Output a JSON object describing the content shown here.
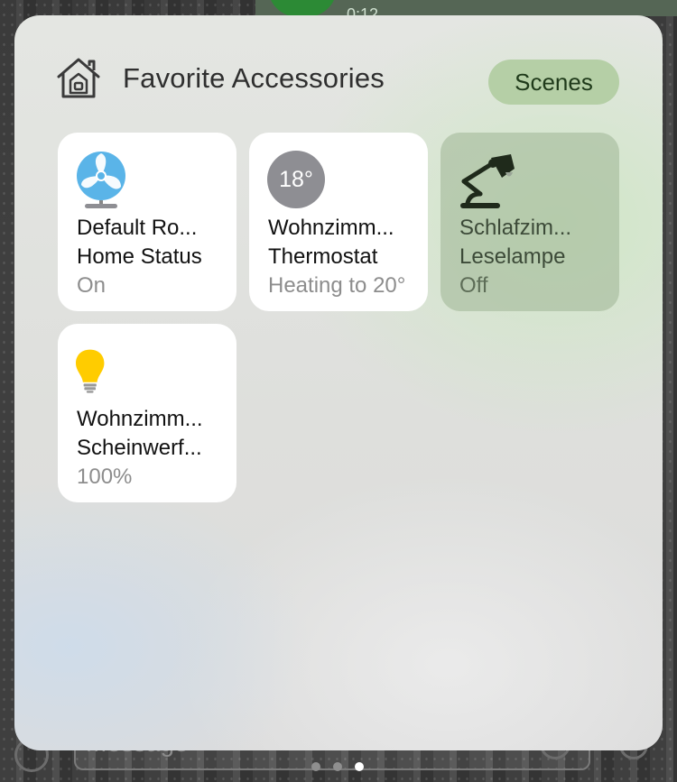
{
  "panel": {
    "title": "Favorite Accessories",
    "scenes_label": "Scenes"
  },
  "accessories": [
    {
      "name_line1": "Default Ro...",
      "name_line2": "Home Status",
      "status": "On",
      "icon": "fan-icon",
      "state": "on"
    },
    {
      "name_line1": "Wohnzimm...",
      "name_line2": "Thermostat",
      "status": "Heating to 20°",
      "icon": "thermostat-icon",
      "badge": "18°",
      "state": "on"
    },
    {
      "name_line1": "Schlafzim...",
      "name_line2": "Leselampe",
      "status": "Off",
      "icon": "desk-lamp-icon",
      "state": "off"
    },
    {
      "name_line1": "Wohnzimm...",
      "name_line2": "Scheinwerf...",
      "status": "100%",
      "icon": "lightbulb-icon",
      "state": "on"
    }
  ],
  "background": {
    "message_placeholder": "Message",
    "time": "0:12"
  },
  "page_indicator": {
    "count": 3,
    "active": 3
  },
  "colors": {
    "scenes_button": "#b5cfa6",
    "fan_blue": "#5ab4e8",
    "bulb_yellow": "#ffcc00",
    "lamp_dark": "#1f2a1b",
    "thermo_badge": "#8e8e93"
  }
}
